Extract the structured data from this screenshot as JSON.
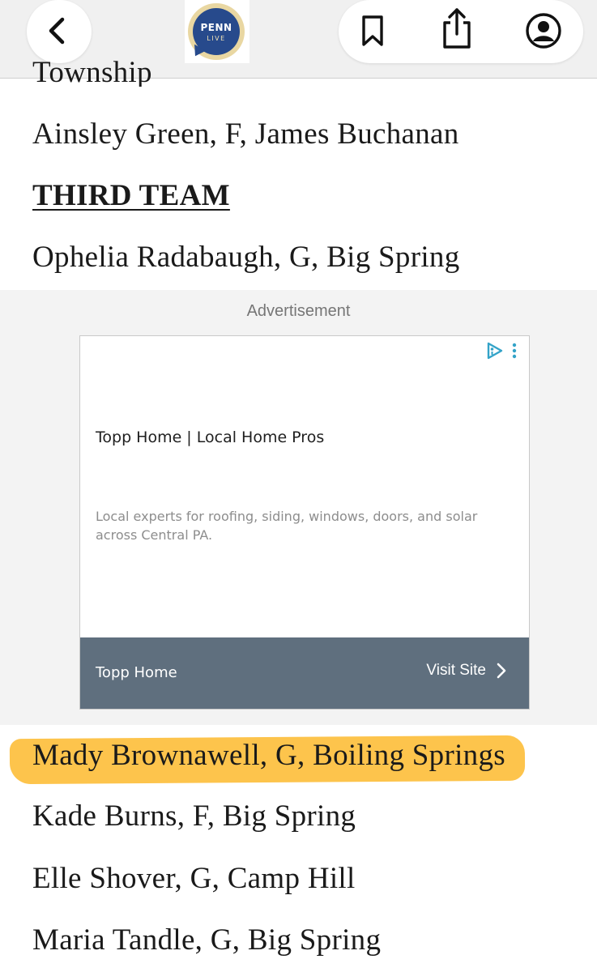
{
  "header": {
    "logo_top": "PENN",
    "logo_bottom": "LIVE",
    "back_icon": "chevron-left-icon",
    "bookmark_icon": "bookmark-icon",
    "share_icon": "share-icon",
    "account_icon": "user-circle-icon"
  },
  "article": {
    "clipped_line": "Township",
    "line_1": "Ainsley Green, F, James Buchanan",
    "heading": "THIRD TEAM",
    "line_2": "Ophelia Radabaugh, G, Big Spring",
    "line_3": "Mady Brownawell, G, Boiling Springs",
    "line_4": "Kade Burns, F, Big Spring",
    "line_5": "Elle Shover, G, Camp Hill",
    "line_6": "Maria Tandle, G, Big Spring"
  },
  "ad": {
    "label": "Advertisement",
    "title": "Topp Home | Local Home Pros",
    "description": "Local experts for roofing, siding, windows, doors, and solar across Central PA.",
    "brand": "Topp Home",
    "cta": "Visit Site"
  },
  "colors": {
    "highlight": "#fdbf3d",
    "logo_blue": "#274a8c",
    "ad_footer": "#5f6f7e"
  }
}
